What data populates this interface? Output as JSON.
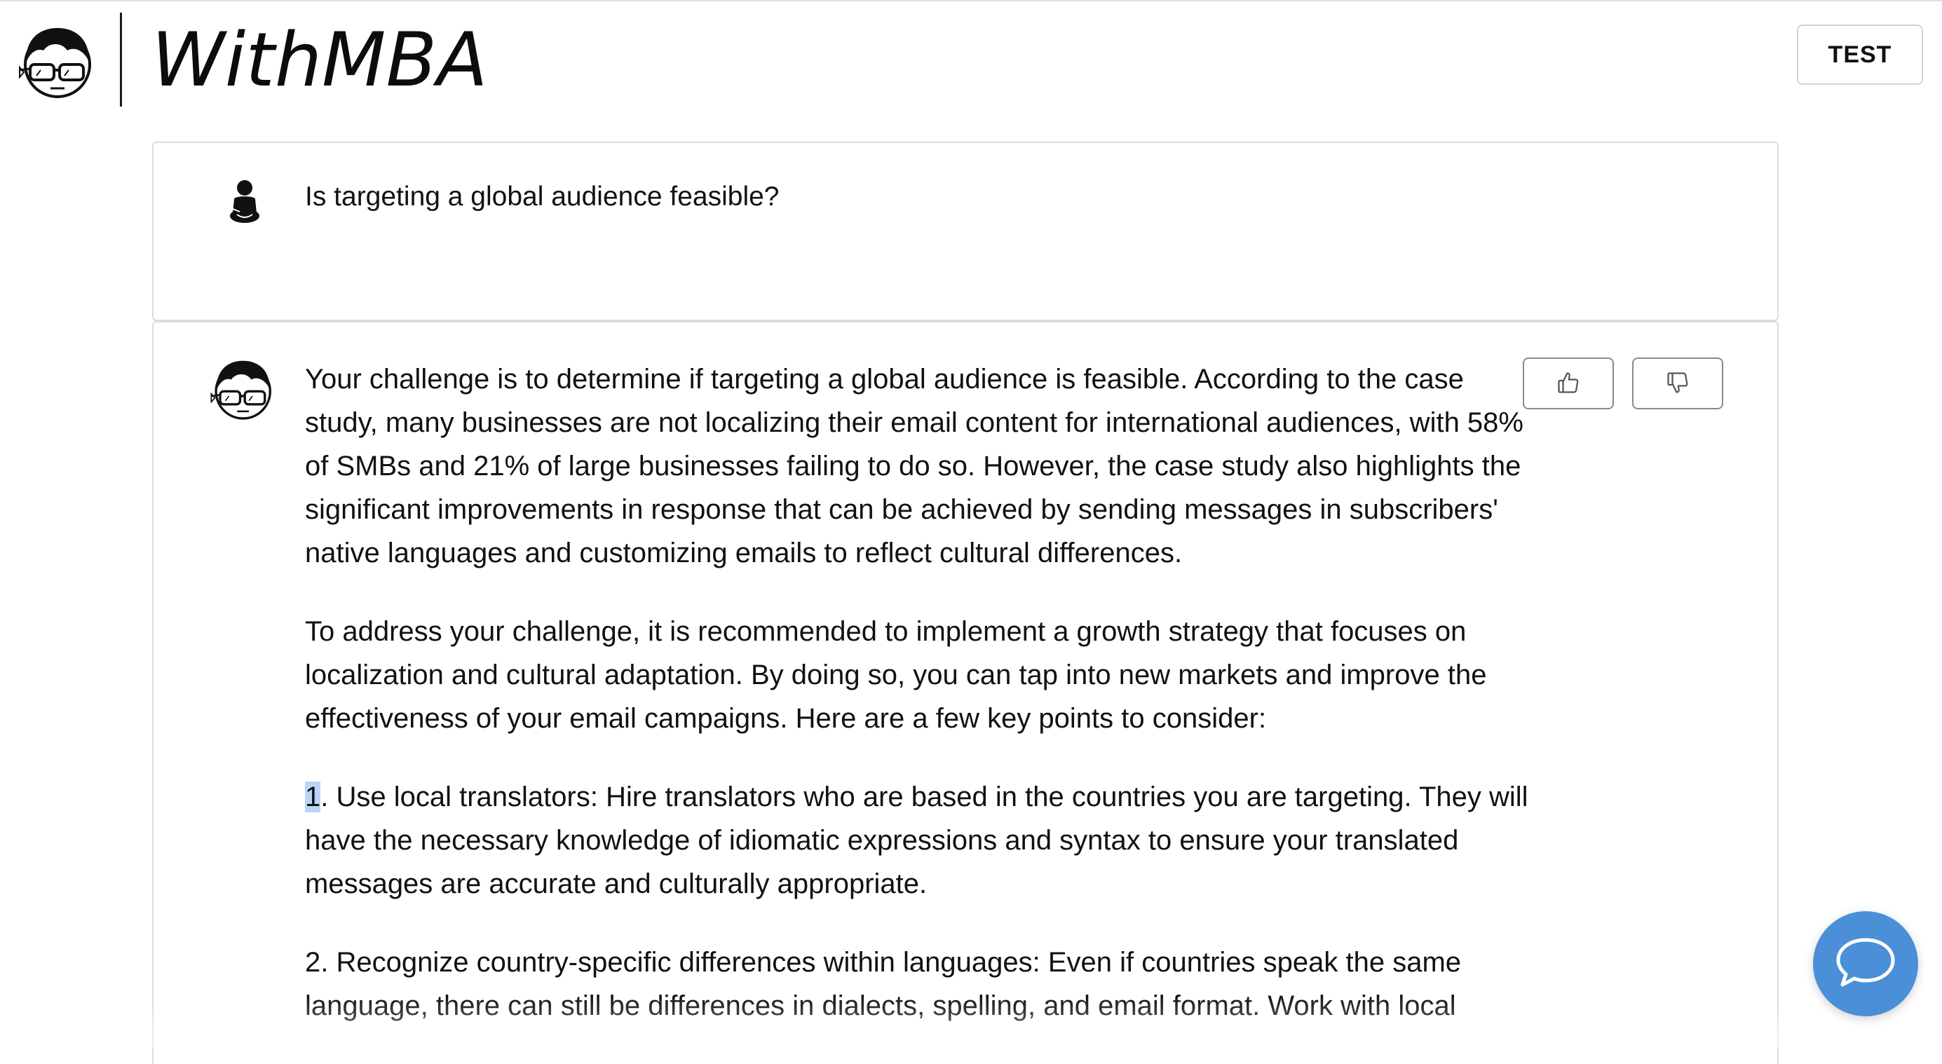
{
  "header": {
    "brand": "WithMBA",
    "test_button_label": "TEST"
  },
  "conversation": {
    "question": "Is targeting a global audience feasible?",
    "answer": {
      "p1": "Your challenge is to determine if targeting a global audience is feasible. According to the case study, many businesses are not localizing their email content for international audiences, with 58% of SMBs and 21% of large businesses failing to do so. However, the case study also highlights the significant improvements in response that can be achieved by sending messages in subscribers' native languages and customizing emails to reflect cultural differences.",
      "p2": "To address your challenge, it is recommended to implement a growth strategy that focuses on localization and cultural adaptation. By doing so, you can tap into new markets and improve the effectiveness of your email campaigns. Here are a few key points to consider:",
      "p3_selected": "1",
      "p3_rest": ". Use local translators: Hire translators who are based in the countries you are targeting. They will have the necessary knowledge of idiomatic expressions and syntax to ensure your translated messages are accurate and culturally appropriate.",
      "p4": "2. Recognize country-specific differences within languages: Even if countries speak the same language, there can still be differences in dialects, spelling, and email format. Work with local"
    }
  },
  "icons": {
    "logo": "glasses-boy-avatar-icon",
    "user": "user-silhouette-icon",
    "bot": "glasses-boy-avatar-icon",
    "thumbs_up": "thumbs-up-icon",
    "thumbs_down": "thumbs-down-icon",
    "chat": "chat-bubble-icon"
  },
  "colors": {
    "accent": "#4a8fd8",
    "selection": "#bcd4f5",
    "border": "#dcdcdc"
  }
}
